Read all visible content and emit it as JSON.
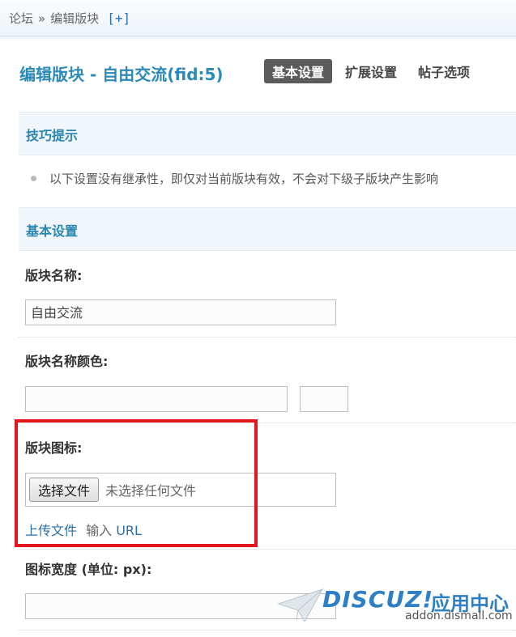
{
  "breadcrumb": {
    "root": "论坛",
    "separator": "»",
    "current": "编辑版块",
    "add": "[+]"
  },
  "header": {
    "title": "编辑版块 - 自由交流(fid:5)",
    "tabs": [
      {
        "label": "基本设置",
        "active": true
      },
      {
        "label": "扩展设置",
        "active": false
      },
      {
        "label": "帖子选项",
        "active": false
      }
    ]
  },
  "tips": {
    "title": "技巧提示",
    "text": "以下设置没有继承性，即仅对当前版块有效，不会对下级子版块产生影响"
  },
  "basic": {
    "title": "基本设置",
    "name_label": "版块名称:",
    "name_value": "自由交流",
    "color_label": "版块名称颜色:",
    "color_value": "",
    "icon_label": "版块图标:",
    "file_button": "选择文件",
    "file_status": "未选择任何文件",
    "upload_link": "上传文件",
    "input_prefix": "输入",
    "input_url": "URL",
    "width_label": "图标宽度 (单位: px):",
    "width_value": ""
  },
  "watermark": {
    "brand": "DISCUZ!",
    "center": "应用中心",
    "url": "addon.dismall.com"
  },
  "colors": {
    "accent": "#2b8ab8",
    "highlight": "#e3161d",
    "tab_active": "#5b5b5b"
  }
}
